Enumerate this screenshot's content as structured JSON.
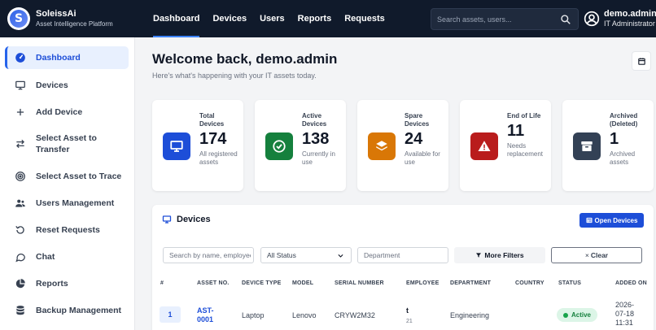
{
  "brand": {
    "name": "SoleissAi",
    "subtitle": "Asset Intelligence Platform",
    "logo_letter": "S"
  },
  "topnav": [
    {
      "label": "Dashboard",
      "active": true
    },
    {
      "label": "Devices"
    },
    {
      "label": "Users"
    },
    {
      "label": "Reports"
    },
    {
      "label": "Requests"
    }
  ],
  "search": {
    "placeholder": "Search assets, users..."
  },
  "user": {
    "name": "demo.admin",
    "role": "IT Administrator"
  },
  "sidebar": {
    "items": [
      {
        "label": "Dashboard",
        "icon": "dashboard-icon",
        "active": true
      },
      {
        "label": "Devices",
        "icon": "monitor-icon"
      },
      {
        "label": "Add Device",
        "icon": "plus-icon"
      },
      {
        "label": "Select Asset to Transfer",
        "icon": "transfer-icon"
      },
      {
        "label": "Select Asset to Trace",
        "icon": "target-icon"
      },
      {
        "label": "Users Management",
        "icon": "users-icon"
      },
      {
        "label": "Reset Requests",
        "icon": "reset-icon"
      },
      {
        "label": "Chat",
        "icon": "chat-icon"
      },
      {
        "label": "Reports",
        "icon": "pie-chart-icon"
      },
      {
        "label": "Backup Management",
        "icon": "database-icon"
      }
    ]
  },
  "main": {
    "welcome": "Welcome back, demo.admin",
    "subtitle": "Here's what's happening with your IT assets today."
  },
  "stats": [
    {
      "label": "Total Devices",
      "value": "174",
      "desc": "All registered assets",
      "color": "#1d4ed8"
    },
    {
      "label": "Active Devices",
      "value": "138",
      "desc": "Currently in use",
      "color": "#15803d"
    },
    {
      "label": "Spare Devices",
      "value": "24",
      "desc": "Available for use",
      "color": "#d97706"
    },
    {
      "label": "End of Life",
      "value": "11",
      "desc": "Needs replacement",
      "color": "#b91c1c"
    },
    {
      "label": "Archived (Deleted)",
      "value": "1",
      "desc": "Archived assets",
      "color": "#334155"
    }
  ],
  "devices": {
    "title": "Devices",
    "open_button": "Open Devices",
    "filters": {
      "search_placeholder": "Search by name, employee",
      "status_value": "All Status",
      "department_placeholder": "Department",
      "more_filters": "More Filters",
      "clear": "Clear"
    },
    "columns": [
      "#",
      "ASSET NO.",
      "DEVICE TYPE",
      "MODEL",
      "SERIAL NUMBER",
      "EMPLOYEE",
      "DEPARTMENT",
      "COUNTRY",
      "STATUS",
      "ADDED ON"
    ],
    "rows": [
      {
        "num": "1",
        "asset_no_1": "AST-",
        "asset_no_2": "0001",
        "device_type": "Laptop",
        "model": "Lenovo",
        "serial": "CRYW2M32",
        "employee": "t",
        "employee_id": "21",
        "department": "Engineering",
        "country": "",
        "status": "Active",
        "added_1": "2026-",
        "added_2": "07-18",
        "added_3": "11:31"
      }
    ]
  }
}
